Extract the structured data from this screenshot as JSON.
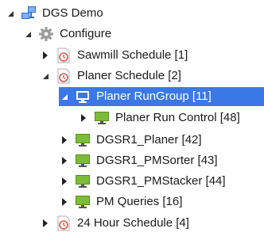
{
  "tree": {
    "root": {
      "label": "DGS Demo",
      "icon": "network-computers-icon"
    },
    "configure": {
      "label": "Configure",
      "icon": "gear-icon"
    },
    "sawmill": {
      "label": "Sawmill Schedule [1]",
      "icon": "schedule-clock-icon"
    },
    "planer_schedule": {
      "label": "Planer Schedule [2]",
      "icon": "schedule-clock-icon"
    },
    "planer_rungroup": {
      "label": "Planer RunGroup [11]",
      "icon": "monitor-icon",
      "selected": true
    },
    "planer_run_control": {
      "label": "Planer Run Control [48]",
      "icon": "monitor-icon"
    },
    "dgsr1_planer": {
      "label": "DGSR1_Planer [42]",
      "icon": "monitor-icon"
    },
    "dgsr1_pmsorter": {
      "label": "DGSR1_PMSorter [43]",
      "icon": "monitor-icon"
    },
    "dgsr1_pmstacker": {
      "label": "DGSR1_PMStacker [44]",
      "icon": "monitor-icon"
    },
    "pm_queries": {
      "label": "PM Queries [16]",
      "icon": "monitor-icon"
    },
    "hour24": {
      "label": "24 Hour Schedule [4]",
      "icon": "schedule-clock-icon"
    }
  },
  "colors": {
    "selection": "#3b78e7",
    "monitor_green": "#7dbb3a",
    "clock_red": "#e2574c",
    "network_blue": "#2f6fd1"
  }
}
